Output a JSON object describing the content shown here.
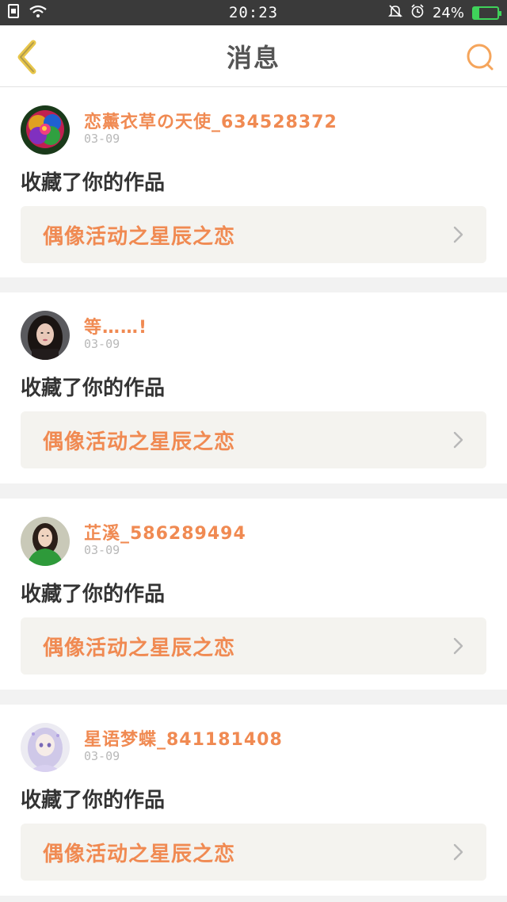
{
  "status_bar": {
    "time": "20:23",
    "battery_percent": "24%",
    "battery_level": 0.24,
    "battery_color": "#3fd25a",
    "icons": [
      "sim-icon",
      "wifi-icon",
      "bell-muted-icon",
      "alarm-icon",
      "battery-icon"
    ]
  },
  "header": {
    "title": "消息",
    "back_icon": "back-chevron-icon",
    "search_icon": "search-icon",
    "accent_color": "#f5a55c"
  },
  "messages": [
    {
      "user": "恋薰衣草の天使_634528372",
      "date": "03-09",
      "action": "收藏了你的作品",
      "work_title": "偶像活动之星辰之恋",
      "avatar": "rainbow-rose-avatar"
    },
    {
      "user": "等……!",
      "date": "03-09",
      "action": "收藏了你的作品",
      "work_title": "偶像活动之星辰之恋",
      "avatar": "portrait-dark-hair-avatar"
    },
    {
      "user": "芷溪_586289494",
      "date": "03-09",
      "action": "收藏了你的作品",
      "work_title": "偶像活动之星辰之恋",
      "avatar": "portrait-green-jacket-avatar"
    },
    {
      "user": "星语梦蝶_841181408",
      "date": "03-09",
      "action": "收藏了你的作品",
      "work_title": "偶像活动之星辰之恋",
      "avatar": "anime-girl-avatar"
    }
  ],
  "colors": {
    "username": "#f08a52",
    "work_title": "#f08a52",
    "link_background": "#f4f3ef",
    "page_background": "#f2f2f2"
  }
}
